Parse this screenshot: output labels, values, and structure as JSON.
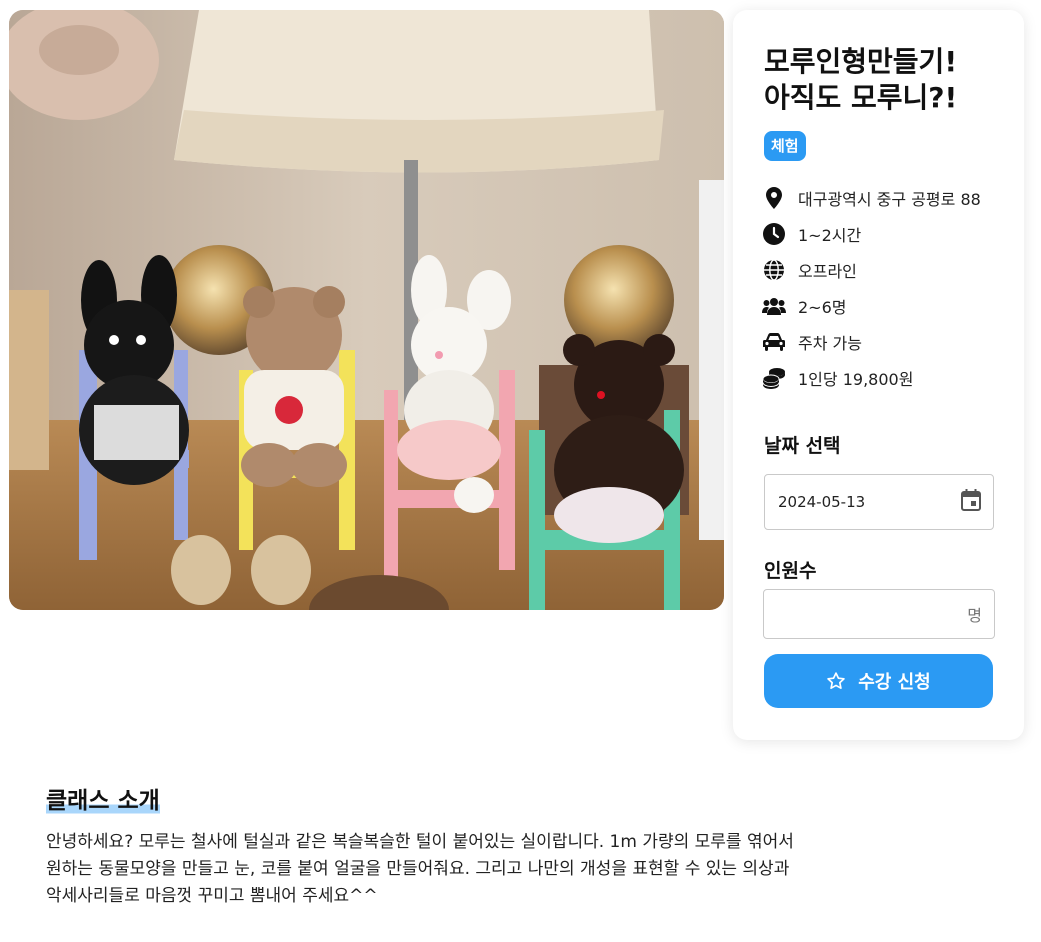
{
  "class": {
    "title": "모루인형만들기!\n아직도 모루니?!",
    "badge": "체험",
    "info": [
      {
        "icon": "location-pin-icon",
        "text": "대구광역시 중구 공평로 88"
      },
      {
        "icon": "clock-icon",
        "text": "1~2시간"
      },
      {
        "icon": "globe-icon",
        "text": "오프라인"
      },
      {
        "icon": "users-icon",
        "text": "2~6명"
      },
      {
        "icon": "car-icon",
        "text": "주차 가능"
      },
      {
        "icon": "coins-icon",
        "text": "1인당 19,800원"
      }
    ]
  },
  "booking": {
    "date_label": "날짜 선택",
    "date_value": "2024-05-13",
    "people_label": "인원수",
    "people_value": "",
    "people_unit": "명",
    "apply_label": "수강 신청"
  },
  "intro": {
    "title": "클래스 소개",
    "body": "안녕하세요? 모루는 철사에 털실과 같은 복슬복슬한 털이 붙어있는 실이랍니다. 1m 가량의 모루를 엮어서 원하는 동물모양을 만들고 눈, 코를 붙여 얼굴을 만들어줘요. 그리고 나만의 개성을 표현할 수 있는 의상과 악세사리들로 마음껏 꾸미고 뽐내어 주세요^^"
  },
  "colors": {
    "accent": "#2b9af3",
    "highlight": "#a9d6fb"
  }
}
